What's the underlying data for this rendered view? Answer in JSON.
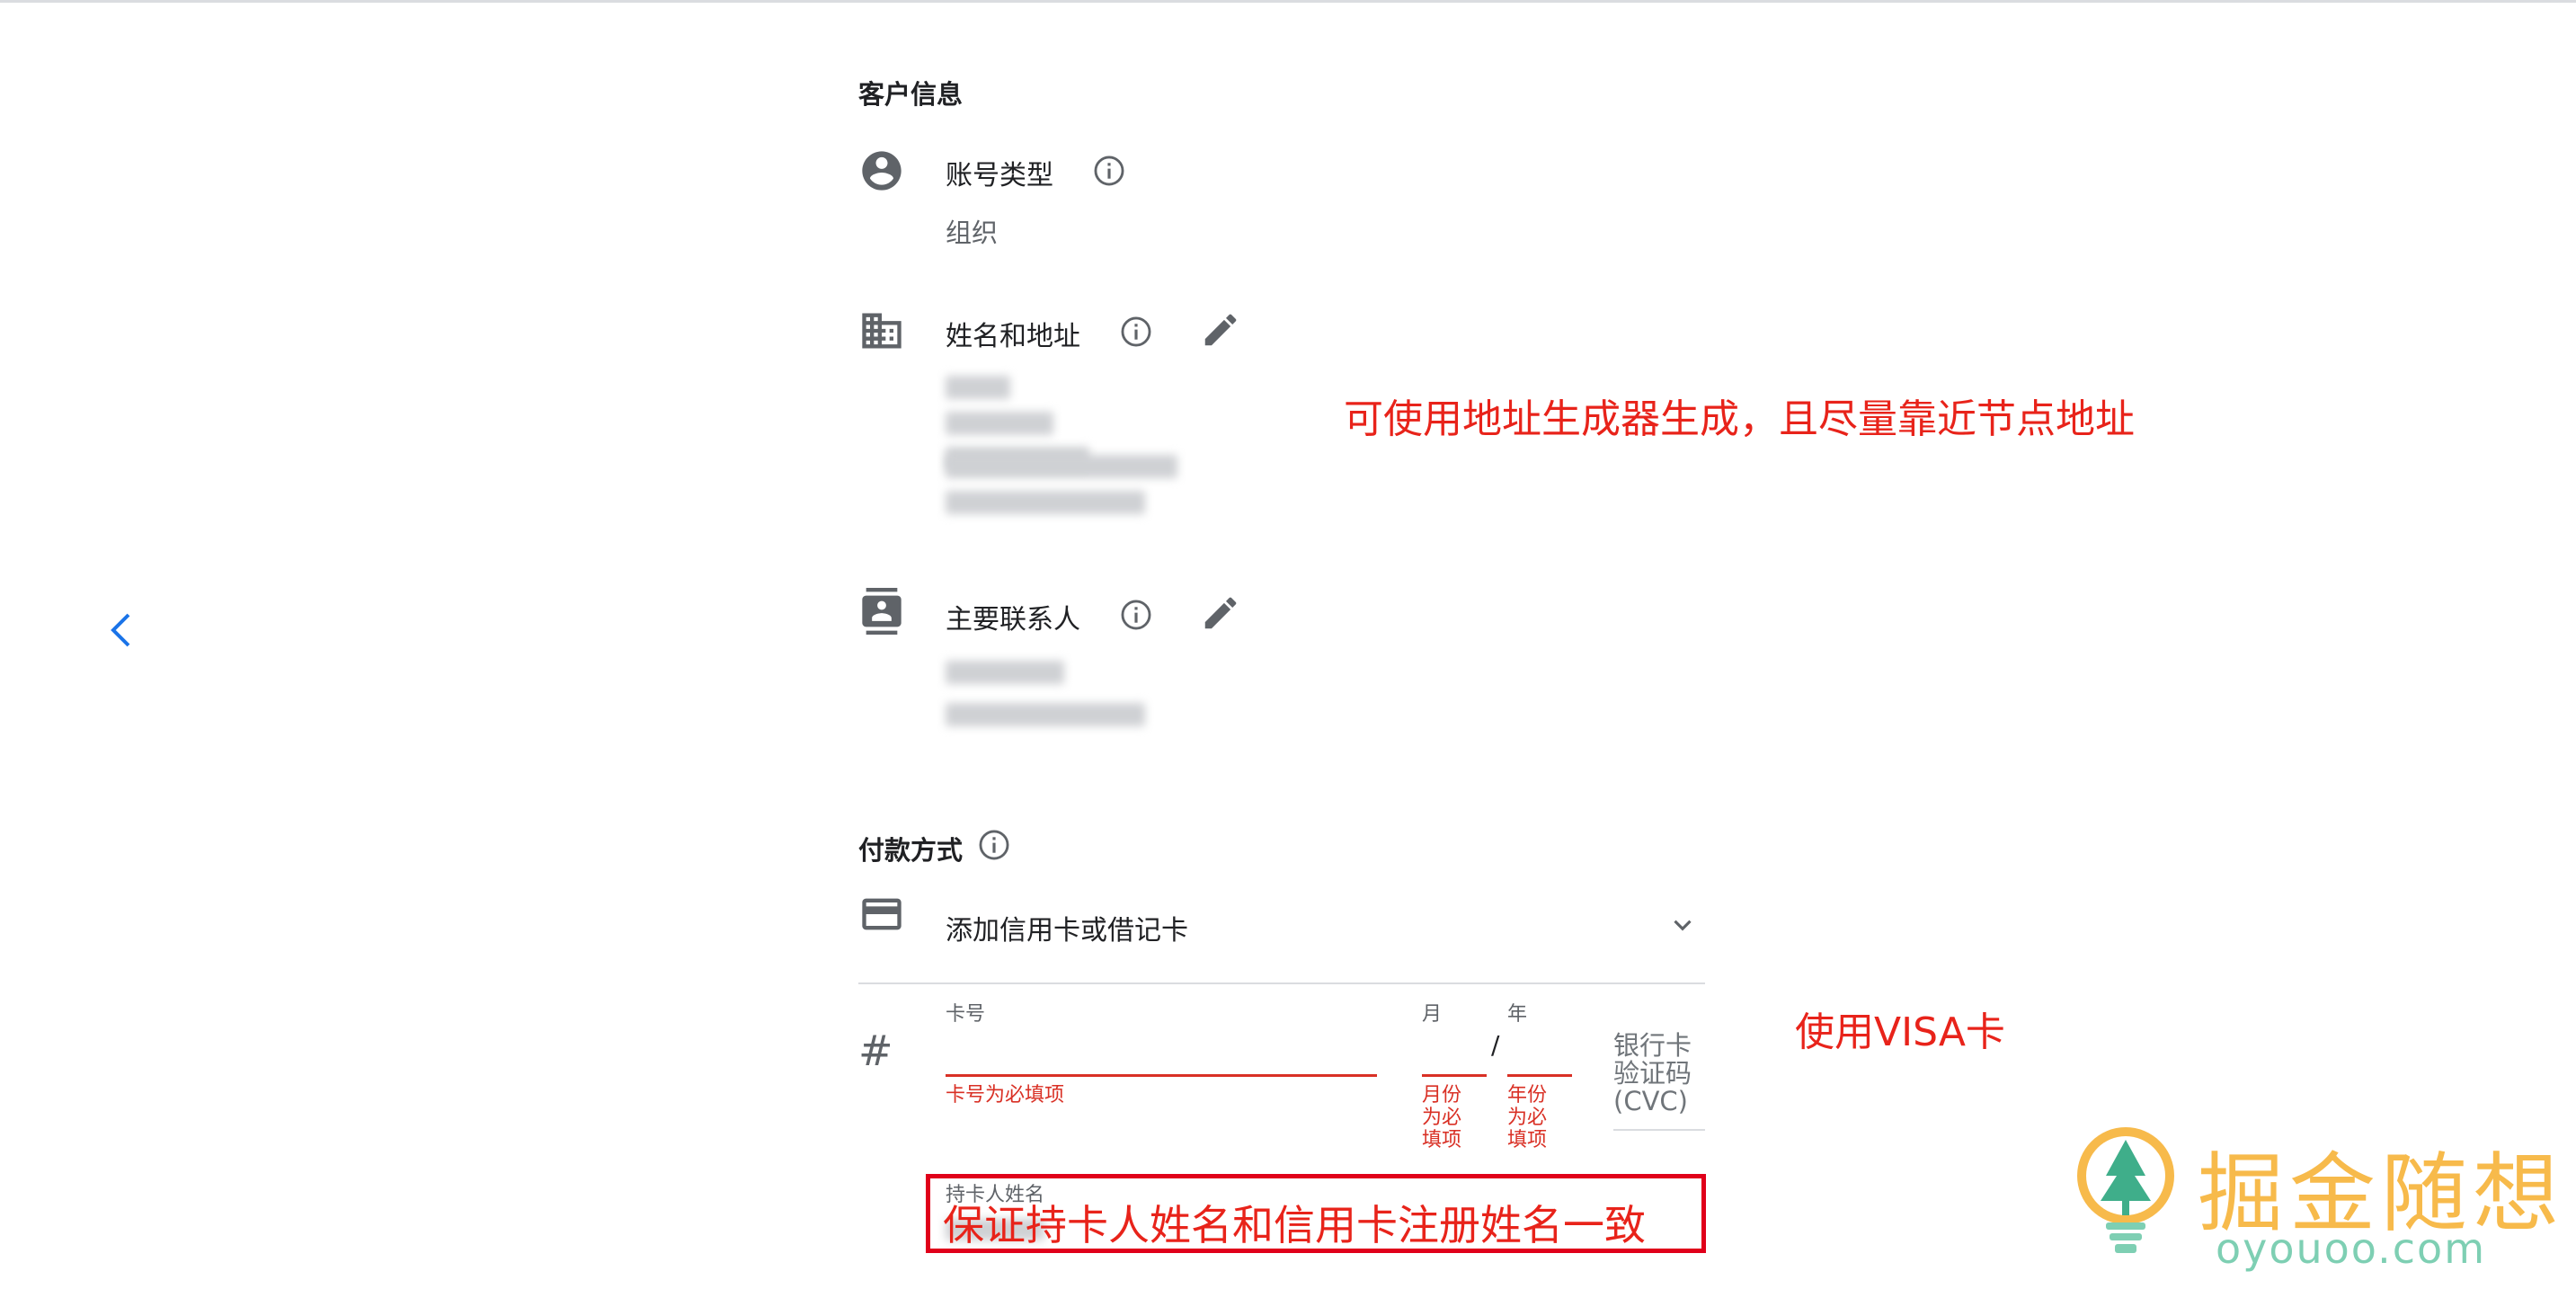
{
  "customer_info": {
    "title": "客户信息",
    "account_type": {
      "label": "账号类型",
      "value": "组织",
      "icon": "account-circle-icon"
    },
    "name_address": {
      "label": "姓名和地址",
      "icon": "business-icon"
    },
    "primary_contact": {
      "label": "主要联系人",
      "icon": "contact-card-icon"
    }
  },
  "payment": {
    "title": "付款方式",
    "add_card_label": "添加信用卡或借记卡",
    "card_number_label": "卡号",
    "card_number_error": "卡号为必填项",
    "month_label": "月",
    "year_label": "年",
    "date_separator": "/",
    "month_error": "月份为必填项",
    "year_error": "年份为必填项",
    "cvc_label": "银行卡验证码(CVC)",
    "cardholder_label": "持卡人姓名",
    "hash_symbol": "#"
  },
  "annotations": {
    "address_note": "可使用地址生成器生成，且尽量靠近节点地址",
    "visa_note": "使用VISA卡",
    "name_note": "保证持卡人姓名和信用卡注册姓名一致"
  },
  "watermark": {
    "title": "掘金随想",
    "url": "oyouoo.com"
  },
  "colors": {
    "error": "#d93025",
    "annotation": "#e8231a",
    "accent": "#1a73e8",
    "icon": "#5f6368"
  }
}
